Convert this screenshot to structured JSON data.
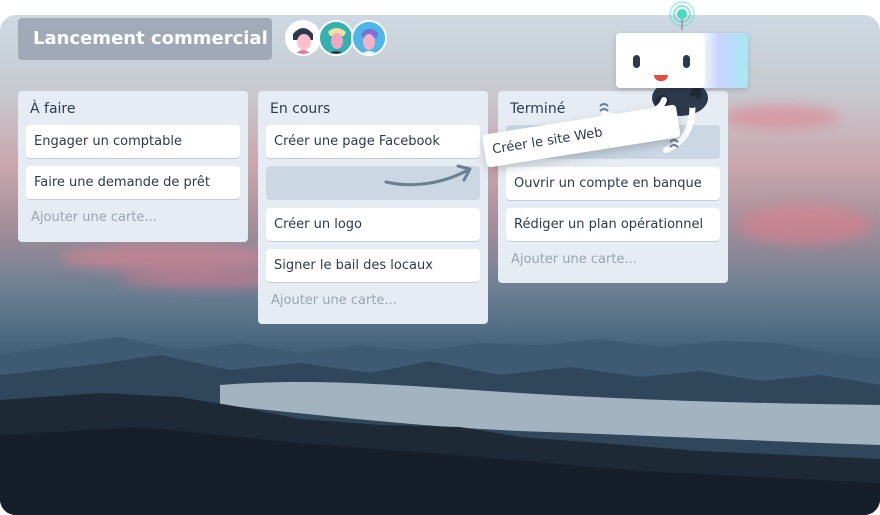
{
  "board": {
    "title": "Lancement commercial",
    "members": [
      {
        "name": "avatar-1",
        "color": "#ffffff",
        "skin": "#ffc0cb",
        "hair": "#2d3a4c"
      },
      {
        "name": "avatar-2",
        "color": "#33b0b0",
        "skin": "#f0a8c0",
        "hair": "#2d3a4c"
      },
      {
        "name": "avatar-3",
        "color": "#4fb7e8",
        "skin": "#f4b1c8",
        "hair": "#7a6fd6"
      }
    ]
  },
  "lists": [
    {
      "title": "À faire",
      "cards": [
        "Engager un comptable",
        "Faire une demande de prêt"
      ],
      "add_label": "Ajouter une carte..."
    },
    {
      "title": "En cours",
      "cards": [
        "Créer une page Facebook",
        "Créer un logo",
        "Signer le bail des locaux"
      ],
      "add_label": "Ajouter une carte..."
    },
    {
      "title": "Terminé",
      "cards": [
        "Ouvrir un compte en banque",
        "Rédiger un plan opérationnel"
      ],
      "add_label": "Ajouter une carte..."
    }
  ],
  "dragging_card": "Créer le site Web",
  "colors": {
    "list_bg": "#e6ecf4",
    "card_text": "#2d3a4c",
    "placeholder": "#cbd8e4",
    "title_badge": "#96a0af",
    "robot_accent": "#44ddc2"
  }
}
